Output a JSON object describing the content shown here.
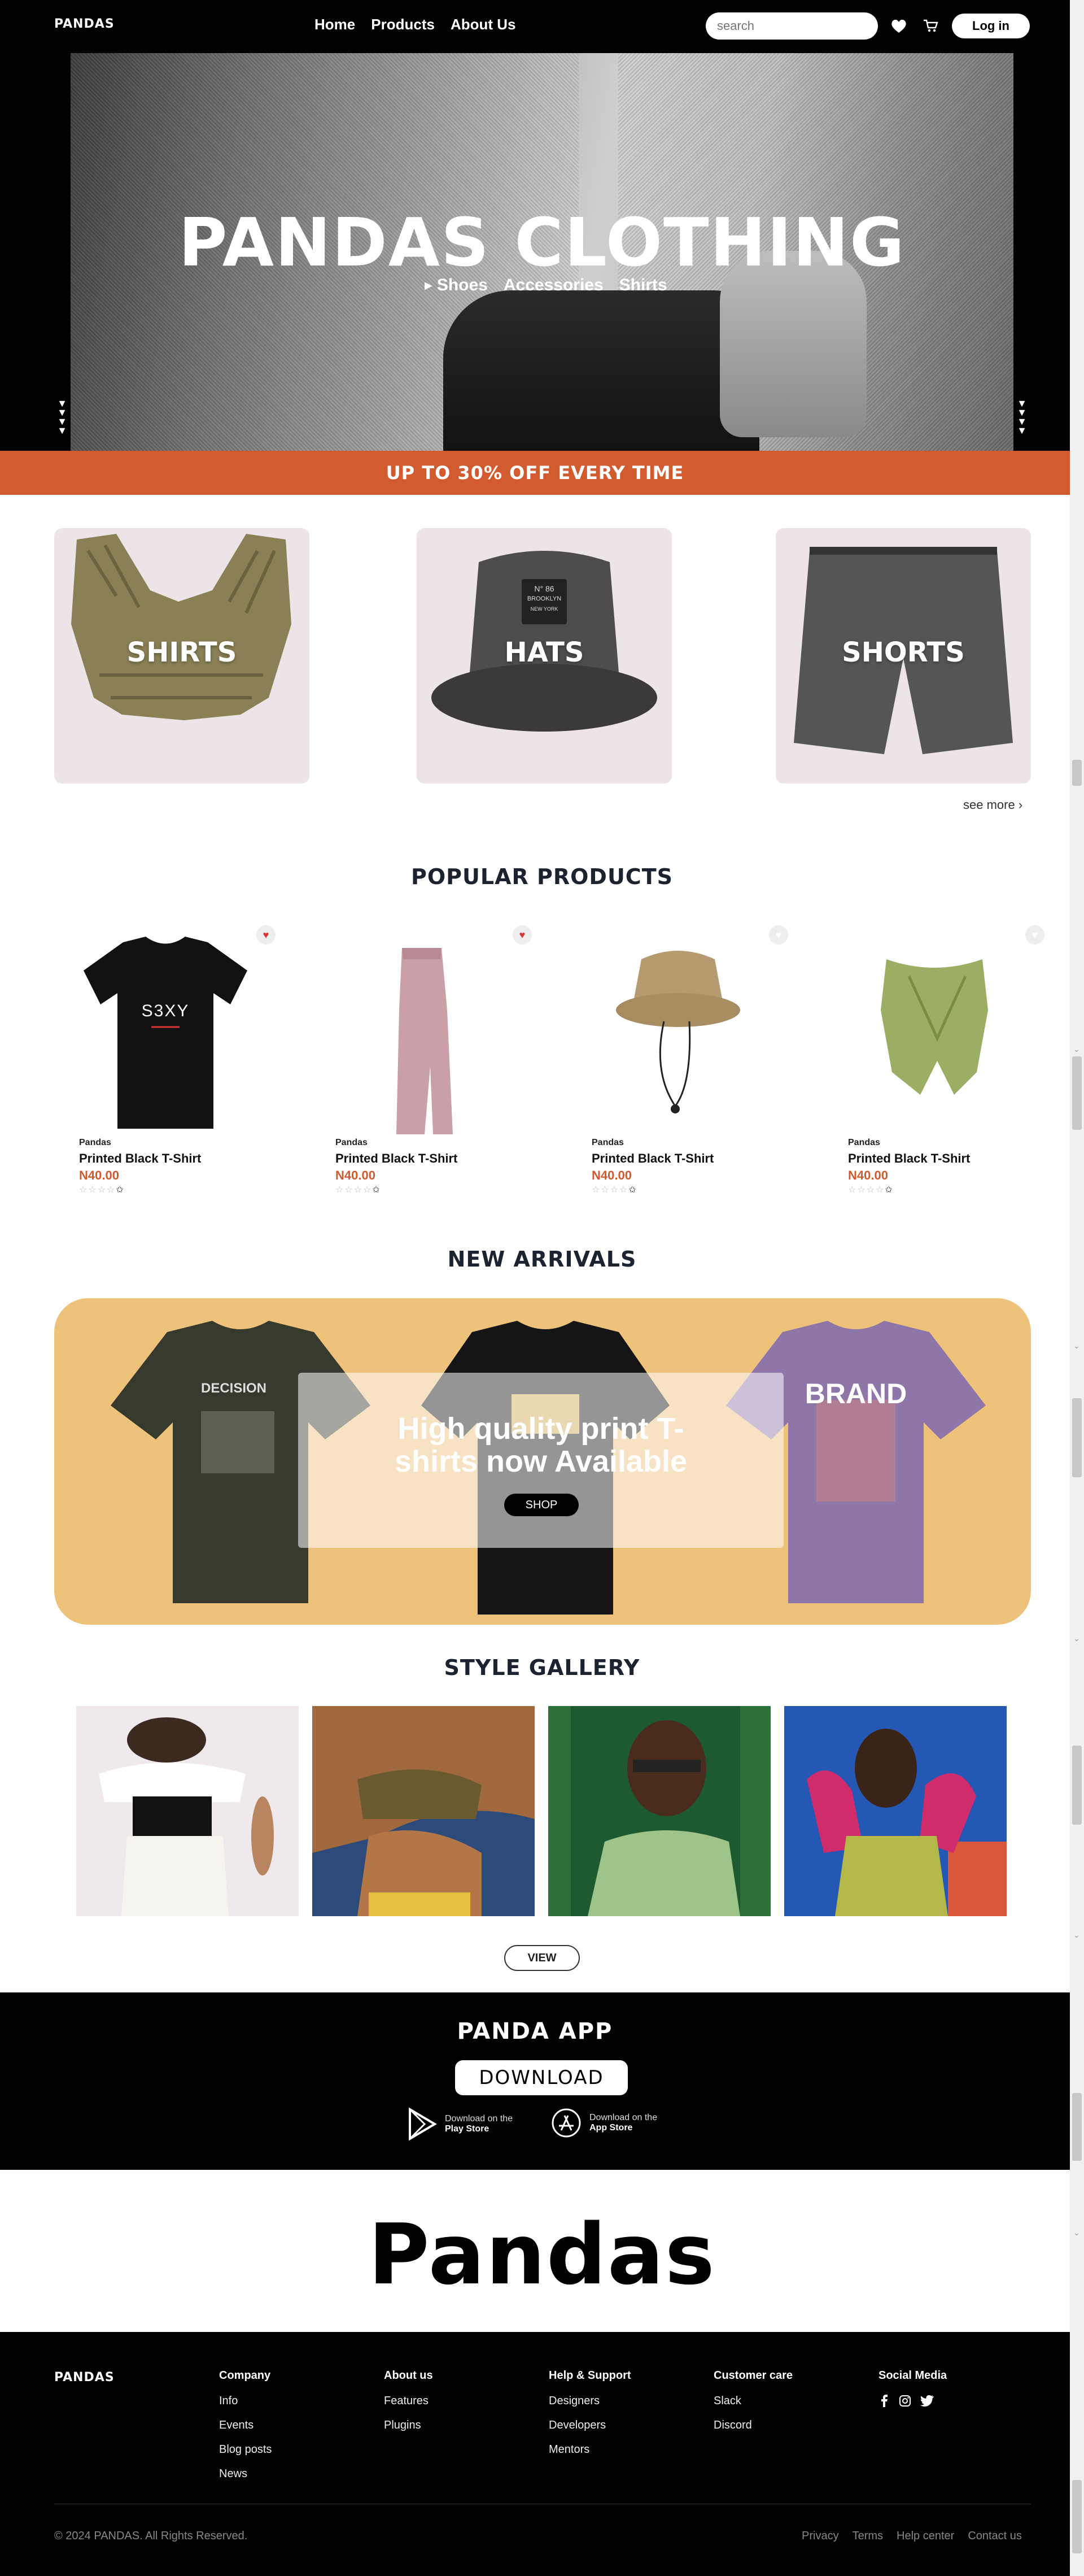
{
  "header": {
    "logo": "PANDAS",
    "nav": [
      "Home",
      "Products",
      "About Us"
    ],
    "search_placeholder": "search",
    "login_label": "Log in",
    "icons": [
      "heart-icon",
      "cart-icon"
    ]
  },
  "hero": {
    "title": "PANDAS CLOTHING",
    "categories": [
      "Shoes",
      "Accessories",
      "Shirts"
    ]
  },
  "promo": "UP TO 30% OFF EVERY TIME",
  "categories": {
    "items": [
      "SHIRTS",
      "HATS",
      "SHORTS"
    ],
    "see_more": "see more",
    "hat_badge": [
      "N° 86",
      "BROOKLYN",
      "NEW YORK"
    ]
  },
  "popular": {
    "title": "POPULAR PRODUCTS",
    "items": [
      {
        "brand": "Pandas",
        "name": "Printed Black T-Shirt",
        "price": "N40.00",
        "print": "S3XY",
        "fav": true
      },
      {
        "brand": "Pandas",
        "name": "Printed Black T-Shirt",
        "price": "N40.00",
        "fav": true
      },
      {
        "brand": "Pandas",
        "name": "Printed Black T-Shirt",
        "price": "N40.00",
        "fav": false
      },
      {
        "brand": "Pandas",
        "name": "Printed Black T-Shirt",
        "price": "N40.00",
        "fav": false
      }
    ],
    "stars": "☆☆☆☆",
    "star_last": "✩"
  },
  "arrivals": {
    "title": "NEW ARRIVALS",
    "headline": "High quality print T-shirts now Available",
    "shop_label": "SHOP",
    "shirt_prints": [
      "DECISION",
      "BRAND"
    ]
  },
  "gallery": {
    "title": "STYLE GALLERY",
    "view_label": "VIEW"
  },
  "app": {
    "title": "PANDA APP",
    "download_label": "DOWNLOAD",
    "play_t1": "Download on the",
    "play_t2": "Play Store",
    "app_t1": "Download on the",
    "app_t2": "App Store"
  },
  "bigword": "Pandas",
  "footer": {
    "logo": "PANDAS",
    "columns": [
      {
        "title": "Company",
        "links": [
          "Info",
          "Events",
          "Blog posts",
          "News"
        ]
      },
      {
        "title": "About us",
        "links": [
          "Features",
          "Plugins"
        ]
      },
      {
        "title": "Help & Support",
        "links": [
          "Designers",
          "Developers",
          "Mentors"
        ]
      },
      {
        "title": "Customer care",
        "links": [
          "Slack",
          "Discord"
        ]
      }
    ],
    "social_title": "Social Media",
    "copyright": "© 2024 PANDAS. All Rights Reserved.",
    "bottom_links": [
      "Privacy",
      "Terms",
      "Help center",
      "Contact us"
    ]
  },
  "colors": {
    "accent": "#d15a2f",
    "arrivals_bg": "#eec27a",
    "card_bg": "#ece4e6"
  }
}
